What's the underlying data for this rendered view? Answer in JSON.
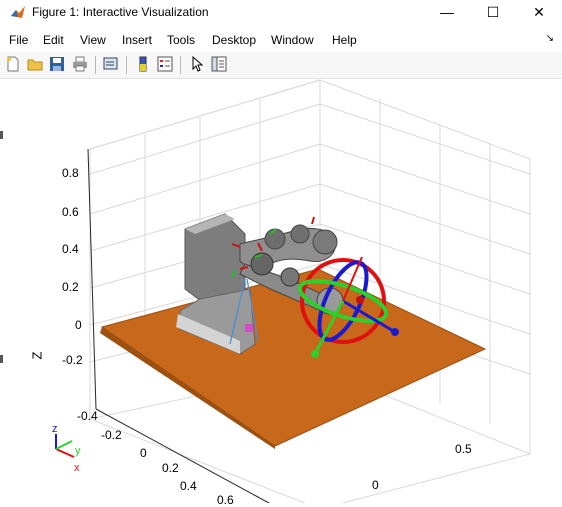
{
  "window": {
    "title": "Figure 1: Interactive Visualization",
    "minimize": "—",
    "maximize": "☐",
    "close": "✕"
  },
  "menu": [
    "File",
    "Edit",
    "View",
    "Insert",
    "Tools",
    "Desktop",
    "Window",
    "Help"
  ],
  "toolbar": [
    "new-figure",
    "open-file",
    "save",
    "print",
    "link-plot",
    "colorbar",
    "legend",
    "pointer",
    "property-inspector"
  ],
  "axes": {
    "zlabel": "Z",
    "zticks": [
      "0.8",
      "0.6",
      "0.4",
      "0.2",
      "0",
      "-0.2"
    ],
    "yticks": [
      "-0.4",
      "-0.2",
      "0",
      "0.2",
      "0.4",
      "0.6"
    ],
    "xticks": [
      "0.5",
      "0"
    ]
  },
  "triad": {
    "x": "x",
    "y": "y",
    "z": "z"
  },
  "colors": {
    "floor": "#c8681a",
    "ring_red": "#e01010",
    "ring_blue": "#1a1ad0",
    "ring_green": "#2bd12b",
    "robot": "#8a8a8a"
  }
}
